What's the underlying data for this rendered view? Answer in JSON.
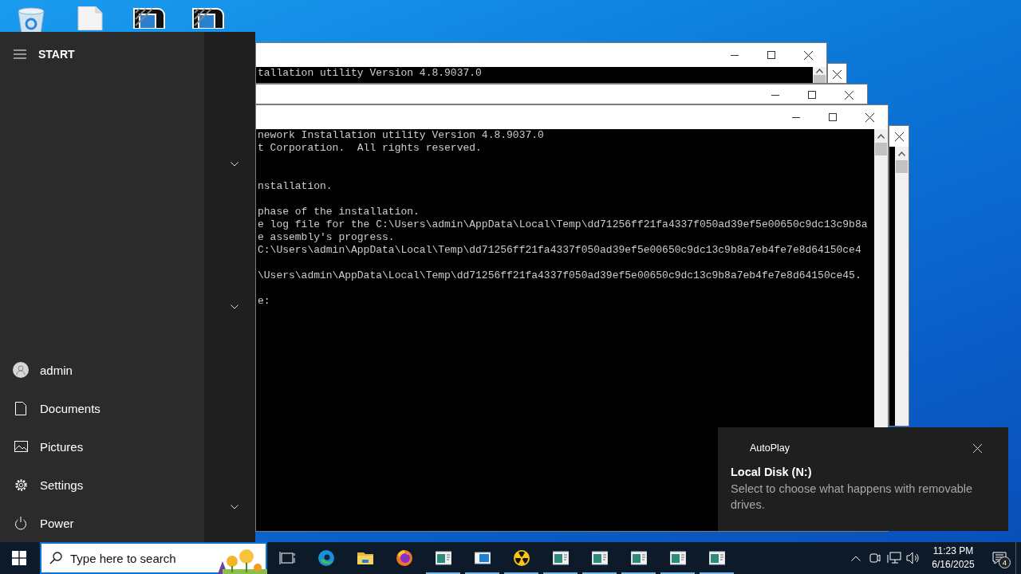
{
  "desktop": {
    "icons": [
      {
        "kind": "recycle-bin"
      },
      {
        "kind": "file"
      },
      {
        "kind": "striped-logo"
      },
      {
        "kind": "striped-logo"
      }
    ]
  },
  "windows": [
    {
      "buttons": [
        {
          "kind": "close"
        }
      ]
    },
    {
      "buttons": [
        {
          "kind": "close"
        }
      ],
      "scrollbar": true
    },
    {
      "buttons": [
        {
          "kind": "minimize"
        },
        {
          "kind": "maximize"
        },
        {
          "kind": "close"
        }
      ],
      "paragraphs": [
        [
          "tallation utility Version 4.8.9037.0"
        ]
      ],
      "scrollbar": true
    },
    {
      "buttons": [
        {
          "kind": "minimize"
        },
        {
          "kind": "maximize"
        },
        {
          "kind": "close"
        }
      ]
    },
    {
      "buttons": [
        {
          "kind": "minimize"
        },
        {
          "kind": "maximize"
        },
        {
          "kind": "close"
        }
      ],
      "scrollbar": true,
      "paragraphs": [
        [
          "nework Installation utility Version 4.8.9037.0",
          "t Corporation.  All rights reserved."
        ],
        [
          "nstallation."
        ],
        [
          "phase of the installation.",
          "e log file for the C:\\Users\\admin\\AppData\\Local\\Temp\\dd71256ff21fa4337f050ad39ef5e00650c9dc13c9b8a",
          "e assembly's progress.",
          "C:\\Users\\admin\\AppData\\Local\\Temp\\dd71256ff21fa4337f050ad39ef5e00650c9dc13c9b8a7eb4fe7e8d64150ce4"
        ],
        [
          "\\Users\\admin\\AppData\\Local\\Temp\\dd71256ff21fa4337f050ad39ef5e00650c9dc13c9b8a7eb4fe7e8d64150ce45."
        ],
        [
          "e:"
        ]
      ]
    }
  ],
  "start_menu": {
    "title": "START",
    "items": [
      {
        "label": "admin",
        "kind": "user"
      },
      {
        "label": "Documents",
        "kind": "documents"
      },
      {
        "label": "Pictures",
        "kind": "pictures"
      },
      {
        "label": "Settings",
        "kind": "settings"
      },
      {
        "label": "Power",
        "kind": "power"
      }
    ]
  },
  "toast": {
    "app": "AutoPlay",
    "title": "Local Disk (N:)",
    "body": "Select to choose what happens with removable drives."
  },
  "taskbar": {
    "search": {
      "placeholder": "Type here to search"
    },
    "apps": [
      {
        "kind": "task-view",
        "running": false
      },
      {
        "kind": "edge",
        "running": false
      },
      {
        "kind": "explorer",
        "running": false
      },
      {
        "kind": "firefox",
        "running": false
      },
      {
        "kind": "console",
        "running": true
      },
      {
        "kind": "blue-app",
        "running": true
      },
      {
        "kind": "radiation",
        "running": true
      },
      {
        "kind": "console",
        "running": true
      },
      {
        "kind": "console",
        "running": true
      },
      {
        "kind": "console",
        "running": true
      },
      {
        "kind": "console",
        "running": true
      },
      {
        "kind": "console",
        "running": true
      }
    ],
    "tray": [
      {
        "kind": "chevron"
      },
      {
        "kind": "camera"
      },
      {
        "kind": "network"
      },
      {
        "kind": "volume"
      }
    ],
    "time": "11:23 PM",
    "date": "6/16/2025",
    "notifications": "4"
  }
}
